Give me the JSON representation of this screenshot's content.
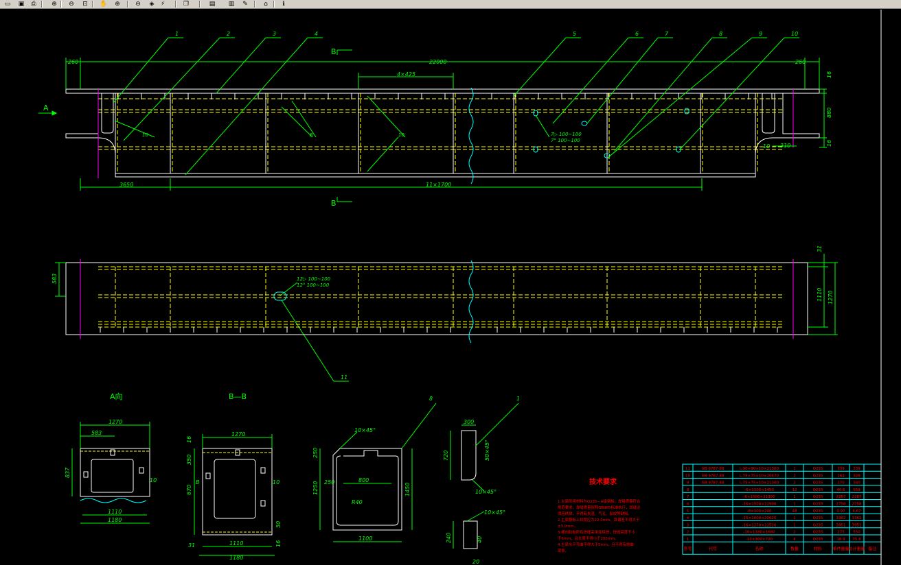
{
  "toolbar": {
    "buttons": [
      {
        "name": "open-icon",
        "glyph": "▭"
      },
      {
        "name": "save-icon",
        "glyph": "▣"
      },
      {
        "name": "print-icon",
        "glyph": "⎙"
      },
      {
        "name": "zoom-in-icon",
        "glyph": "⊕"
      },
      {
        "name": "zoom-out-icon",
        "glyph": "⊖"
      },
      {
        "name": "zoom-window-icon",
        "glyph": "⊡"
      },
      {
        "name": "pan-icon",
        "glyph": "✋"
      },
      {
        "name": "zoom-prev-icon",
        "glyph": "⊕"
      },
      {
        "name": "zoom-extents-icon",
        "glyph": "⊖"
      },
      {
        "name": "layer-icon",
        "glyph": "◈"
      },
      {
        "name": "measure-icon",
        "glyph": "⚡"
      },
      {
        "name": "copy-icon",
        "glyph": "❐"
      },
      {
        "name": "properties-icon",
        "glyph": "▤"
      },
      {
        "name": "layout-icon",
        "glyph": "▥"
      },
      {
        "name": "markup-icon",
        "glyph": "✎"
      },
      {
        "name": "home-icon",
        "glyph": "⌂"
      },
      {
        "name": "info-icon",
        "glyph": "ℹ"
      }
    ]
  },
  "colors": {
    "background": "#000000",
    "outline": "#ffffff",
    "dimension": "#00ff00",
    "hidden": "#ffff00",
    "centerline": "#ff00ff",
    "break": "#00ffff",
    "table": "#00ffff",
    "notes": "#ff0000"
  },
  "drawing": {
    "top_dims": {
      "left": "260",
      "overall": "22000",
      "right": "260",
      "pitch": "4×425",
      "left_len": "3650",
      "span": "11×1700",
      "h1": "16",
      "h2": "880",
      "h3": "16",
      "w1": "310",
      "w2": "10"
    },
    "leaders": [
      "1",
      "2",
      "3",
      "4",
      "5",
      "6",
      "7",
      "8",
      "9",
      "10",
      "11"
    ],
    "section_marks": {
      "b_top": "B",
      "b_bottom": "B",
      "a_arrow": "A"
    },
    "welds": {
      "w1": "10",
      "w2": "8",
      "w3": "10"
    },
    "weld_sizes": {
      "label_a1": "7▷ 100∼100",
      "label_a2": "7° 100∼100",
      "label_b1": "12▷ 100∼100",
      "label_b2": "12° 100∼100"
    },
    "plan_dims": {
      "left": "583",
      "right_top": "31",
      "right_mid": "1110",
      "right_overall": "1270"
    },
    "section_a": {
      "title": "A向",
      "w_top": "1270",
      "w_inner": "583",
      "h_left": "837",
      "w_bottom1": "1110",
      "w_bottom2": "1180",
      "r_small": "10"
    },
    "section_b": {
      "title": "B—B",
      "w_top": "1270",
      "h1": "350",
      "h2": "670",
      "h3": "16",
      "label": "B",
      "r10": "10",
      "w_bottom1": "1110",
      "w_bottom2": "1180",
      "b1": "31",
      "b2": "50",
      "b3": "16"
    },
    "detail_8": {
      "chamfer": "10×45°",
      "h1": "250",
      "h2": "1250",
      "w_top": "250",
      "w_mid": "800",
      "r": "R40",
      "h_right": "1450",
      "w_bottom": "1100"
    },
    "detail_1": {
      "w": "300",
      "h": "720",
      "chamfer1": "50×45°",
      "chamfer2": "10×45°",
      "chamfer3": "10×45°",
      "h2": "240",
      "h3": "40",
      "w2": "20"
    }
  },
  "notes": {
    "title": "技术要求",
    "lines": [
      "1.主梁所用材料为Q235—A级钢板，焊接质量符合",
      "  规范要求，焊缝质量按照GB985标准执行，焊缝必",
      "  须连续焊，不得有夹渣、气孔、裂纹等缺陷。",
      "2.主梁腹板上拱度应为22.0mm，其偏差不得大于",
      "  ±3.0mm。",
      "3.横向肋板所有焊缝采用连续焊，焊缝高度不小",
      "  于6mm，且长度不得小于200mm。",
      "4.主梁水平弯曲不得大于5mm，且不得有翘曲",
      "  现象。"
    ]
  },
  "bom": {
    "headers": [
      "序号",
      "代号",
      "名称",
      "数量",
      "材料",
      "单件重量",
      "总计重量",
      "备注"
    ],
    "rows": [
      [
        "11",
        "GB 9787-88",
        "∟90×90×10×21300",
        "1",
        "Q235",
        "339",
        "339",
        ""
      ],
      [
        "10",
        "GB 9787-88",
        "∟75×75×10×20670",
        "2",
        "Q235",
        "164",
        "328",
        ""
      ],
      [
        "9",
        "GB 9787-88",
        "∟75×75×10×21300",
        "2",
        "Q235",
        "170",
        "340",
        ""
      ],
      [
        "8",
        "",
        "-6×1100×1450",
        "12",
        "Q235",
        "46.6",
        "559",
        ""
      ],
      [
        "7",
        "",
        "-6×1500×21300",
        "1",
        "Q235",
        "2287",
        "2287",
        ""
      ],
      [
        "6",
        "",
        "-16×1500×22900",
        "1",
        "Q235",
        "2758",
        "2758",
        ""
      ],
      [
        "5",
        "",
        "-8×100×240",
        "48",
        "Q235",
        "0.97",
        "4.67",
        ""
      ],
      [
        "4",
        "",
        "-16×1000×20620",
        "1",
        "Q235",
        "3362",
        "3362",
        ""
      ],
      [
        "3",
        "",
        "-16×1270×22520",
        "1",
        "Q235",
        "3951",
        "3951",
        ""
      ],
      [
        "2",
        "",
        "-10×1180×1680",
        "2",
        "Q235",
        "275",
        "550",
        ""
      ],
      [
        "1",
        "",
        "-10×300×720",
        "4",
        "Q235",
        "18.9",
        "75.6",
        ""
      ]
    ]
  }
}
